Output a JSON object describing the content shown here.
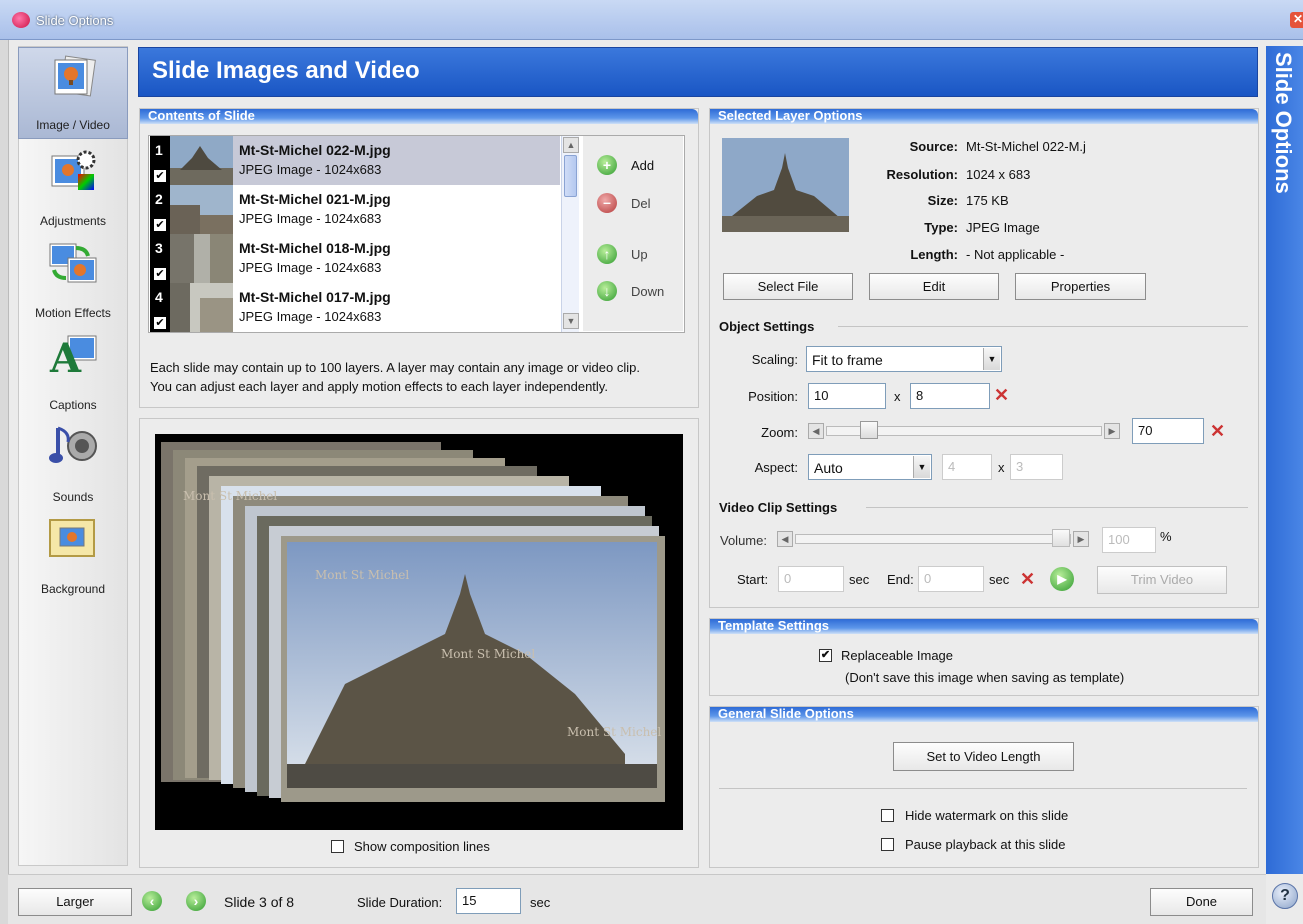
{
  "window": {
    "title": "Slide Options"
  },
  "header": {
    "title": "Slide Images and Video",
    "side_title": "Slide Options"
  },
  "nav": [
    {
      "label": "Image / Video",
      "selected": true,
      "icon": "image-video-icon"
    },
    {
      "label": "Adjustments",
      "icon": "adjustments-icon"
    },
    {
      "label": "Motion Effects",
      "icon": "motion-effects-icon"
    },
    {
      "label": "Captions",
      "icon": "captions-icon"
    },
    {
      "label": "Sounds",
      "icon": "sounds-icon"
    },
    {
      "label": "Background",
      "icon": "background-icon"
    }
  ],
  "contents": {
    "title": "Contents of Slide",
    "layers": [
      {
        "num": "1",
        "name": "Mt-St-Michel 022-M.jpg",
        "desc": "JPEG Image - 1024x683",
        "checked": true
      },
      {
        "num": "2",
        "name": "Mt-St-Michel 021-M.jpg",
        "desc": "JPEG Image - 1024x683",
        "checked": true
      },
      {
        "num": "3",
        "name": "Mt-St-Michel 018-M.jpg",
        "desc": "JPEG Image - 1024x683",
        "checked": true
      },
      {
        "num": "4",
        "name": "Mt-St-Michel 017-M.jpg",
        "desc": "JPEG Image - 1024x683",
        "checked": true
      }
    ],
    "add_label": "Add",
    "del_label": "Del",
    "up_label": "Up",
    "down_label": "Down",
    "info_line1": "Each slide may contain up to 100 layers. A layer may contain any image or video clip.",
    "info_line2": "You can adjust each layer and apply motion effects to each layer independently."
  },
  "preview": {
    "caption1": "Mont St Michel",
    "caption2": "Mont St Michel",
    "caption3": "Mont St Michel",
    "caption4": "Mont St Michel",
    "show_lines_label": "Show composition lines"
  },
  "layer_options": {
    "title": "Selected Layer Options",
    "source_label": "Source:",
    "source": "Mt-St-Michel 022-M.j",
    "resolution_label": "Resolution:",
    "resolution": "1024 x 683",
    "size_label": "Size:",
    "size": "175 KB",
    "type_label": "Type:",
    "type": "JPEG Image",
    "length_label": "Length:",
    "length": "- Not applicable -",
    "select_file": "Select File",
    "edit": "Edit",
    "properties": "Properties"
  },
  "object_settings": {
    "title": "Object Settings",
    "scaling_label": "Scaling:",
    "scaling": "Fit to frame",
    "position_label": "Position:",
    "pos_x": "10",
    "pos_y": "8",
    "x_sep": "x",
    "zoom_label": "Zoom:",
    "zoom": "70",
    "aspect_label": "Aspect:",
    "aspect": "Auto",
    "aspect_w": "4",
    "aspect_h": "3"
  },
  "video_settings": {
    "title": "Video Clip Settings",
    "volume_label": "Volume:",
    "volume": "100",
    "pct": "%",
    "start_label": "Start:",
    "start": "0",
    "sec1": "sec",
    "end_label": "End:",
    "end": "0",
    "sec2": "sec",
    "trim": "Trim Video"
  },
  "template": {
    "title": "Template Settings",
    "replaceable_label": "Replaceable Image",
    "replaceable_note": "(Don't save this image when saving as template)"
  },
  "general": {
    "title": "General Slide Options",
    "set_video_length": "Set to Video Length",
    "hide_watermark": "Hide watermark on this slide",
    "pause_playback": "Pause playback at this slide"
  },
  "footer": {
    "larger": "Larger",
    "slide_status": "Slide 3 of 8",
    "duration_label": "Slide Duration:",
    "duration": "15",
    "sec": "sec",
    "done": "Done"
  }
}
